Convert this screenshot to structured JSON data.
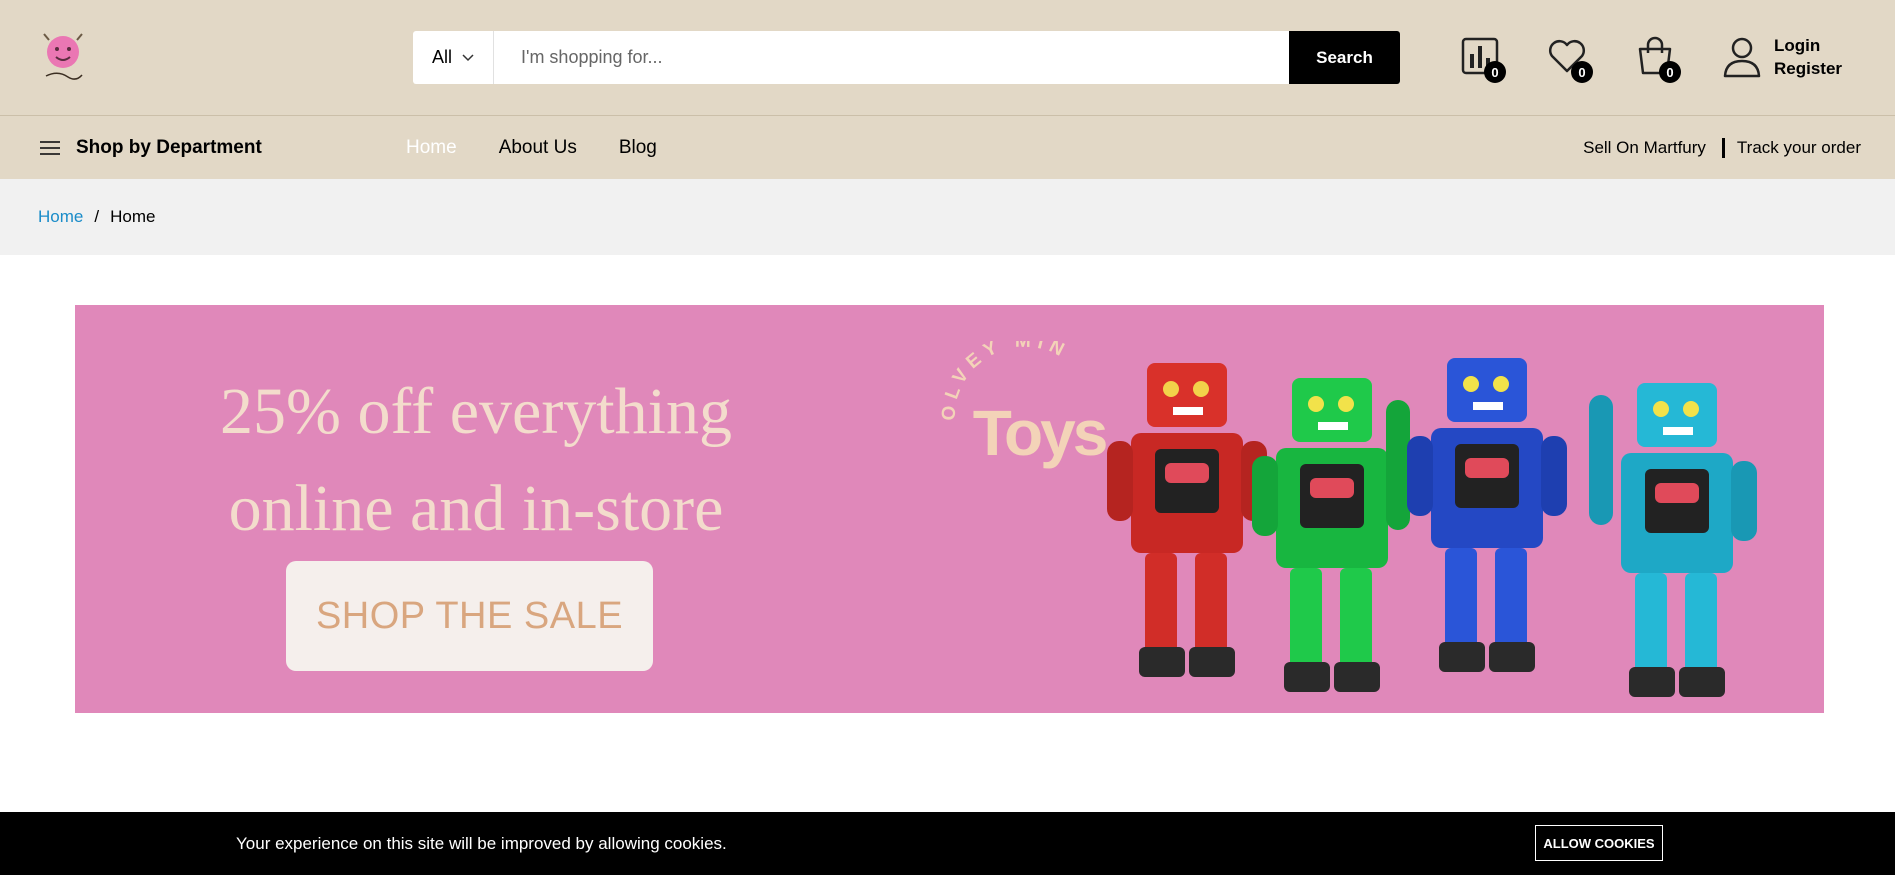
{
  "header": {
    "logo_icon": "toy-store-logo",
    "search": {
      "category": "All",
      "placeholder": "I'm shopping for...",
      "value": "",
      "button_label": "Search"
    },
    "compare_count": "0",
    "wishlist_count": "0",
    "cart_count": "0",
    "login_label": "Login",
    "register_label": "Register"
  },
  "nav": {
    "department_label": "Shop by Department",
    "items": [
      {
        "label": "Home",
        "active": true
      },
      {
        "label": "About Us",
        "active": false
      },
      {
        "label": "Blog",
        "active": false
      }
    ],
    "sell_label": "Sell On Martfury",
    "track_label": "Track your order"
  },
  "breadcrumb": {
    "link": "Home",
    "separator": "/",
    "current": "Home"
  },
  "banner": {
    "headline_line1": "25% off everything",
    "headline_line2": "online and in-store",
    "cta_label": "SHOP THE SALE",
    "brand_top": "OLVEY MIN",
    "brand_name": "Toys",
    "background_color": "#e088ba"
  },
  "cookie": {
    "message": "Your experience on this site will be improved by allowing cookies.",
    "button_label": "ALLOW COOKIES"
  }
}
